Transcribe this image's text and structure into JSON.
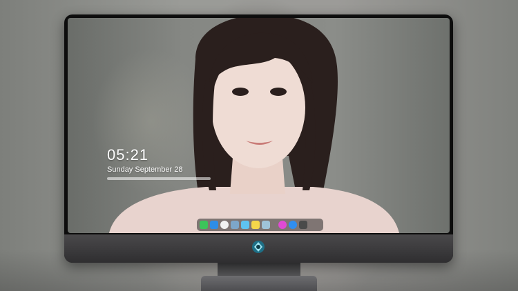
{
  "lockscreen": {
    "time": "05:21",
    "date": "Sunday September  28"
  },
  "dock": {
    "items": [
      {
        "icon": "messages-icon",
        "color": "#3cc45a"
      },
      {
        "icon": "mail-icon",
        "color": "#2e8de6"
      },
      {
        "icon": "clock-icon",
        "color": "#f2f2f2"
      },
      {
        "icon": "preview-icon",
        "color": "#7da6c9"
      },
      {
        "icon": "finder-icon",
        "color": "#5ec3f0"
      },
      {
        "icon": "notes-icon",
        "color": "#f5d64a"
      },
      {
        "icon": "photos-icon",
        "color": "#9fc3d9"
      },
      {
        "icon": "itunes-icon",
        "color": "#e04ad4"
      },
      {
        "icon": "app-store-icon",
        "color": "#2f8ef0"
      },
      {
        "icon": "camera-icon",
        "color": "#4a4a4a"
      }
    ]
  },
  "colors": {
    "bezel": "#0d0d0d",
    "chin": "#3c3b3d",
    "dock_bg": "#282828"
  }
}
